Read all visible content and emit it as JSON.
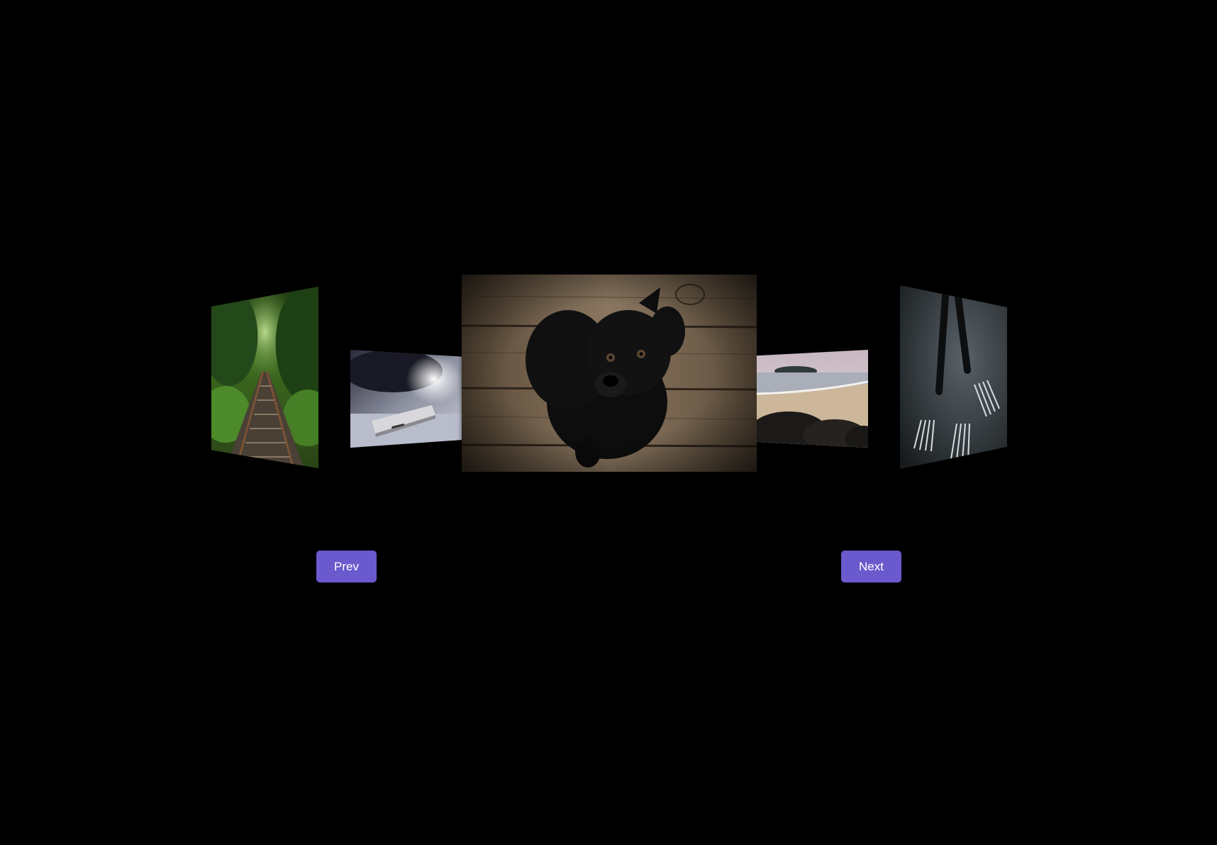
{
  "carousel": {
    "slides": [
      {
        "id": "rail",
        "subject": "railway-tracks-in-forest"
      },
      {
        "id": "phone",
        "subject": "smartphone-on-table"
      },
      {
        "id": "dog",
        "subject": "black-puppy-on-wooden-floor"
      },
      {
        "id": "beach",
        "subject": "beach-with-rocks"
      },
      {
        "id": "forks",
        "subject": "forks-silhouette"
      }
    ],
    "active_index": 2
  },
  "controls": {
    "prev_label": "Prev",
    "next_label": "Next"
  },
  "colors": {
    "background": "#000000",
    "button": "#6a5acd",
    "button_text": "#ffffff"
  }
}
